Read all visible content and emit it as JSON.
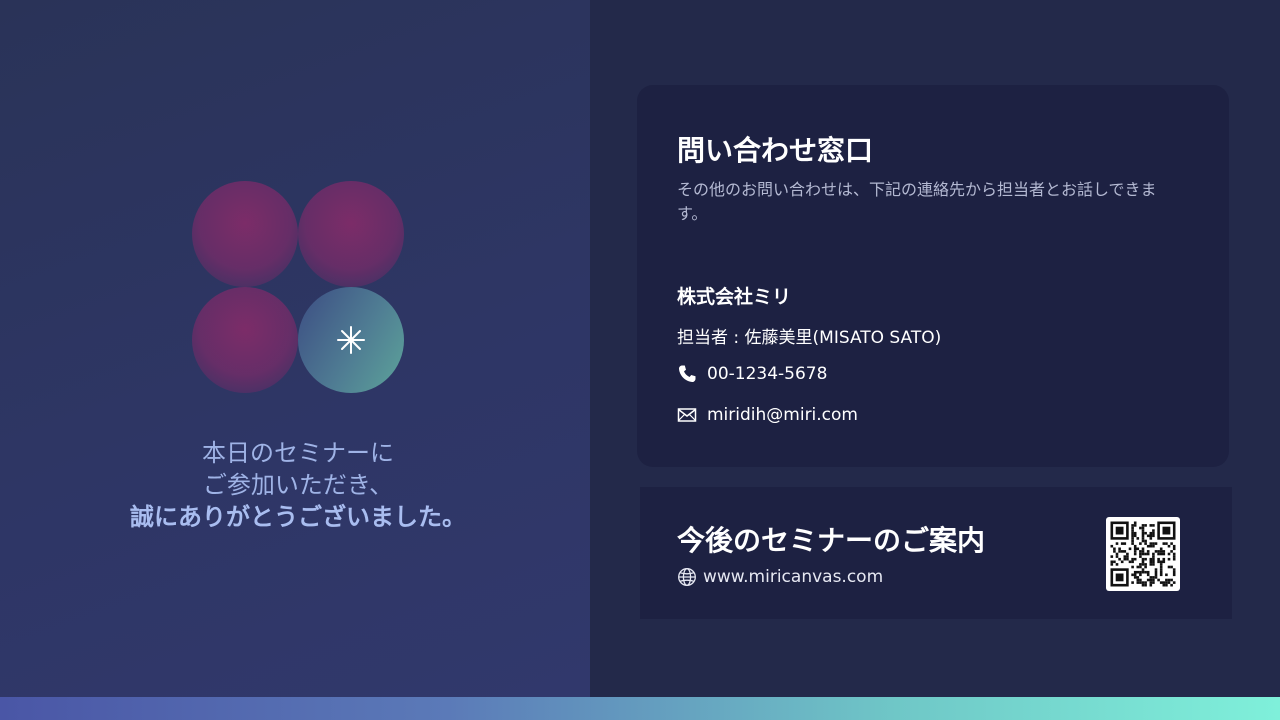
{
  "colors": {
    "background": "#23284a",
    "card": "#1d2142",
    "accent_teal": "#7ff0da",
    "accent_pink": "#7a2c68",
    "thanks_text": "#9fb3e6"
  },
  "logo": {
    "icon": "sparkle-icon"
  },
  "thanks": {
    "line1": "本日のセミナーに",
    "line2": "ご参加いただき、",
    "line3": "誠にありがとうございました。"
  },
  "contact": {
    "title": "問い合わせ窓口",
    "description": "その他のお問い合わせは、下記の連絡先から担当者とお話しできます。",
    "company": "株式会社ミリ",
    "person": "担当者 : 佐藤美里(MISATO SATO)",
    "phone_icon": "phone-icon",
    "phone": "00-1234-5678",
    "email_icon": "mail-icon",
    "email": "miridih@miri.com"
  },
  "seminar": {
    "title": "今後のセミナーのご案内",
    "web_icon": "globe-icon",
    "website": "www.miricanvas.com",
    "qr_icon": "qr-code-icon"
  }
}
